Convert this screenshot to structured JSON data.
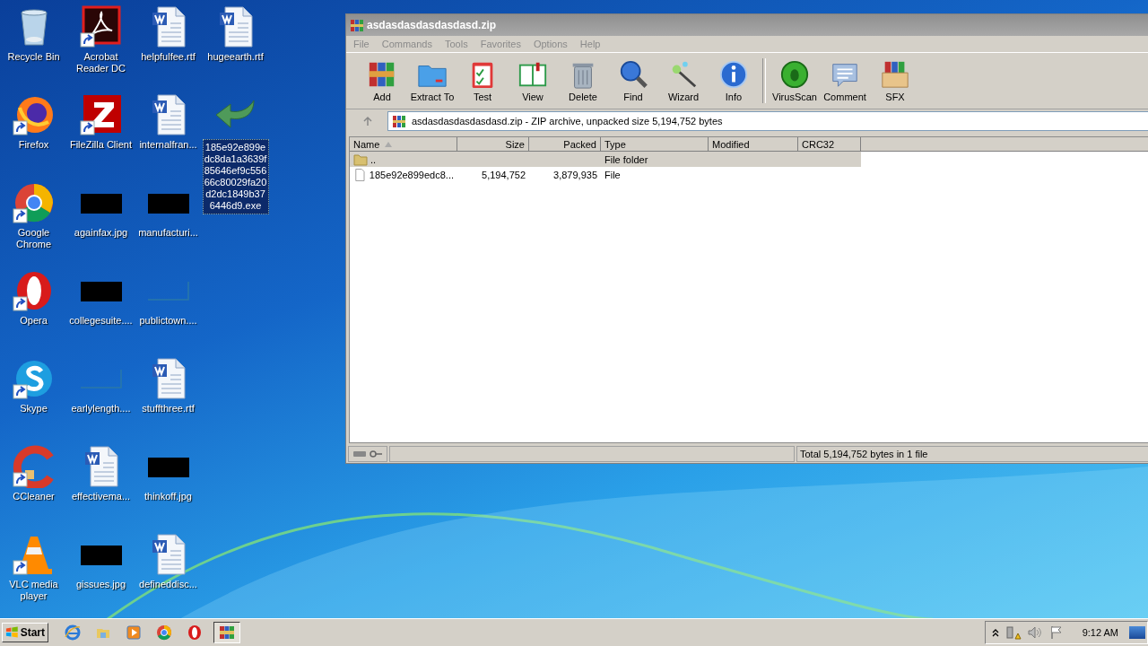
{
  "desktop": {
    "columns": [
      [
        {
          "label": "Recycle Bin",
          "kind": "recycle",
          "shortcut": false,
          "selected": false
        },
        {
          "label": "Firefox",
          "kind": "firefox",
          "shortcut": true,
          "selected": false
        },
        {
          "label": "Google Chrome",
          "kind": "chrome",
          "shortcut": true,
          "selected": false
        },
        {
          "label": "Opera",
          "kind": "opera",
          "shortcut": true,
          "selected": false
        },
        {
          "label": "Skype",
          "kind": "skype",
          "shortcut": true,
          "selected": false
        },
        {
          "label": "CCleaner",
          "kind": "ccleaner",
          "shortcut": true,
          "selected": false
        },
        {
          "label": "VLC media player",
          "kind": "vlc",
          "shortcut": true,
          "selected": false
        }
      ],
      [
        {
          "label": "Acrobat Reader DC",
          "kind": "acrobat",
          "shortcut": true,
          "selected": false
        },
        {
          "label": "FileZilla Client",
          "kind": "filezilla",
          "shortcut": true,
          "selected": false
        },
        {
          "label": "againfax.jpg",
          "kind": "thumbnail",
          "shortcut": false,
          "selected": false
        },
        {
          "label": "collegesuite....",
          "kind": "thumbnail",
          "shortcut": false,
          "selected": false
        },
        {
          "label": "earlylength....",
          "kind": "blank-thumbnail",
          "shortcut": false,
          "selected": false
        },
        {
          "label": "effectivema...",
          "kind": "document",
          "shortcut": false,
          "selected": false
        },
        {
          "label": "gissues.jpg",
          "kind": "thumbnail",
          "shortcut": false,
          "selected": false
        }
      ],
      [
        {
          "label": "helpfulfee.rtf",
          "kind": "document",
          "shortcut": false,
          "selected": false
        },
        {
          "label": "internalfran...",
          "kind": "document",
          "shortcut": false,
          "selected": false
        },
        {
          "label": "manufacturi...",
          "kind": "thumbnail",
          "shortcut": false,
          "selected": false
        },
        {
          "label": "publictown....",
          "kind": "blank-thumbnail",
          "shortcut": false,
          "selected": false
        },
        {
          "label": "stuffthree.rtf",
          "kind": "document",
          "shortcut": false,
          "selected": false
        },
        {
          "label": "thinkoff.jpg",
          "kind": "thumbnail",
          "shortcut": false,
          "selected": false
        },
        {
          "label": "defineddisc...",
          "kind": "document",
          "shortcut": false,
          "selected": false
        }
      ],
      [
        {
          "label": "hugeearth.rtf",
          "kind": "document",
          "shortcut": false,
          "selected": false
        },
        {
          "label": "185e92e899edc8da1a3639f85646ef9c55666c80029fa20d2dc1849b376446d9.exe",
          "kind": "installer",
          "shortcut": false,
          "selected": true
        }
      ]
    ]
  },
  "archiver": {
    "title": "asdasdasdasdasdasd.zip",
    "menu": [
      "File",
      "Commands",
      "Tools",
      "Favorites",
      "Options",
      "Help"
    ],
    "toolbar_groups": [
      [
        {
          "label": "Add",
          "kind": "add"
        },
        {
          "label": "Extract To",
          "kind": "extract"
        },
        {
          "label": "Test",
          "kind": "test"
        },
        {
          "label": "View",
          "kind": "view"
        },
        {
          "label": "Delete",
          "kind": "delete"
        },
        {
          "label": "Find",
          "kind": "find"
        },
        {
          "label": "Wizard",
          "kind": "wizard"
        },
        {
          "label": "Info",
          "kind": "info"
        }
      ],
      [
        {
          "label": "VirusScan",
          "kind": "virusscan"
        },
        {
          "label": "Comment",
          "kind": "comment"
        },
        {
          "label": "SFX",
          "kind": "sfx"
        }
      ]
    ],
    "address": "asdasdasdasdasdasd.zip - ZIP archive, unpacked size 5,194,752 bytes",
    "columns": [
      {
        "label": "Name",
        "sorted": true
      },
      {
        "label": "Size",
        "sorted": false
      },
      {
        "label": "Packed",
        "sorted": false
      },
      {
        "label": "Type",
        "sorted": false
      },
      {
        "label": "Modified",
        "sorted": false
      },
      {
        "label": "CRC32",
        "sorted": false
      }
    ],
    "rows": [
      {
        "kind": "folder",
        "name": "..",
        "type": "File folder",
        "selected": true
      },
      {
        "kind": "file",
        "name": "185e92e899edc8...",
        "size": "5,194,752",
        "packed": "3,879,935",
        "type": "File",
        "selected": false
      }
    ],
    "status": "Total 5,194,752 bytes in 1 file"
  },
  "taskbar": {
    "start": "Start",
    "apps": [
      {
        "kind": "ie",
        "pressed": false
      },
      {
        "kind": "explorer",
        "pressed": false
      },
      {
        "kind": "media",
        "pressed": false
      },
      {
        "kind": "chrome",
        "pressed": false
      },
      {
        "kind": "opera",
        "pressed": false
      },
      {
        "kind": "winrar",
        "pressed": true
      }
    ],
    "clock": "9:12 AM"
  }
}
